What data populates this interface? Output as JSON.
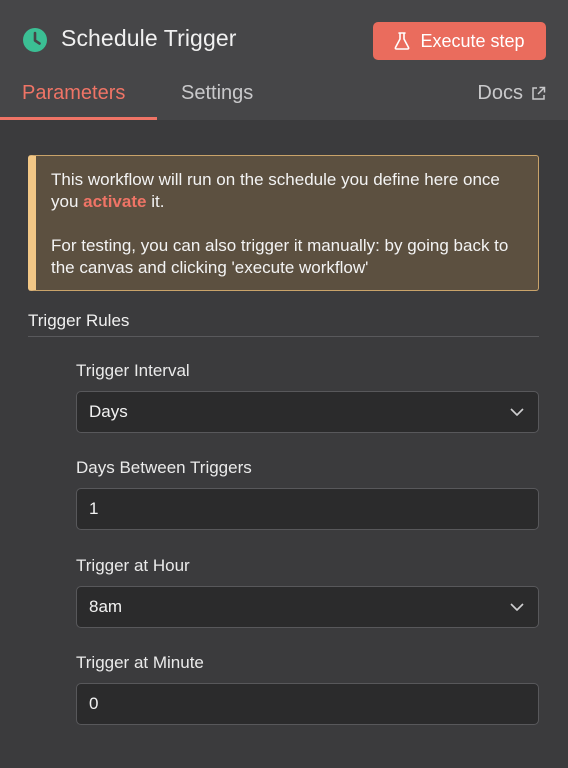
{
  "header": {
    "title": "Schedule Trigger",
    "execute_label": "Execute step",
    "accent_color": "#ea6c5d",
    "node_icon_color": "#3bbf94"
  },
  "tabs": {
    "parameters": "Parameters",
    "settings": "Settings",
    "docs": "Docs",
    "active": "parameters"
  },
  "notice": {
    "line1_before": "This workflow will run on the schedule you define here once you ",
    "activate_link": "activate",
    "line1_after": " it.",
    "line2": "For testing, you can also trigger it manually: by going back to the canvas and clicking 'execute workflow'"
  },
  "rules": {
    "section_title": "Trigger Rules",
    "fields": [
      {
        "label": "Trigger Interval",
        "value": "Days",
        "type": "select"
      },
      {
        "label": "Days Between Triggers",
        "value": "1",
        "type": "input"
      },
      {
        "label": "Trigger at Hour",
        "value": "8am",
        "type": "select"
      },
      {
        "label": "Trigger at Minute",
        "value": "0",
        "type": "input"
      }
    ]
  }
}
